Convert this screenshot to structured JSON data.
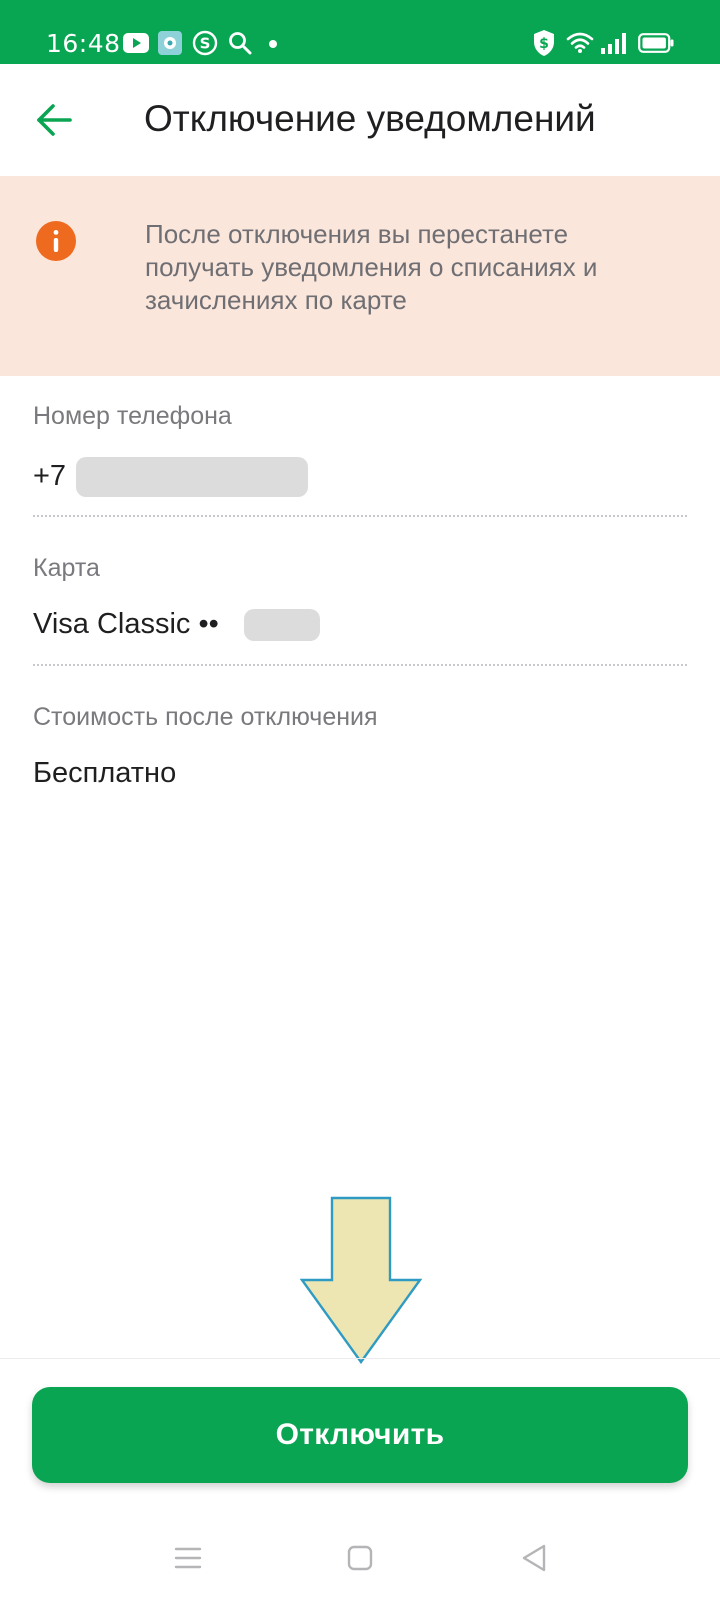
{
  "status_bar": {
    "time": "16:48",
    "icons": [
      "youtube-icon",
      "app-icon",
      "dollar-circle-icon",
      "search-icon",
      "dot-icon",
      "shield-dollar-icon",
      "wifi-icon",
      "signal-icon",
      "battery-icon"
    ]
  },
  "header": {
    "back_icon": "arrow-left-icon",
    "title": "Отключение уведомлений"
  },
  "warning": {
    "icon": "info-icon",
    "text": "После отключения вы перестанете получать уведомления о списаниях и зачислениях по карте"
  },
  "fields": {
    "phone": {
      "label": "Номер телефона",
      "value": "+7"
    },
    "card": {
      "label": "Карта",
      "value": "Visa Classic ••"
    },
    "cost": {
      "label": "Стоимость после отключения",
      "value": "Бесплатно"
    }
  },
  "action": {
    "button_label": "Отключить"
  },
  "colors": {
    "brand_green": "#08a652",
    "banner_bg": "#fbe6dc",
    "info_orange": "#ee6a1e",
    "arrow_fill": "#ede6b2",
    "arrow_stroke": "#2f9bc2"
  },
  "nav_bar": {
    "icons": [
      "menu-icon",
      "home-square-icon",
      "back-triangle-icon"
    ]
  }
}
